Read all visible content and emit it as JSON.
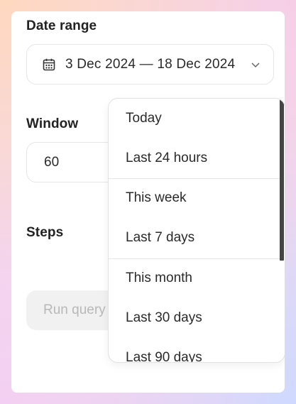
{
  "date_range": {
    "label": "Date range",
    "value": "3 Dec 2024 — 18 Dec 2024",
    "icon": "calendar-icon",
    "dropdown_icon": "chevron-down-icon"
  },
  "window": {
    "label": "Window",
    "value": "60"
  },
  "steps": {
    "label": "Steps"
  },
  "run_button": {
    "label": "Run query"
  },
  "dropdown": {
    "options": [
      "Today",
      "Last 24 hours",
      "This week",
      "Last 7 days",
      "This month",
      "Last 30 days",
      "Last 90 days"
    ]
  }
}
